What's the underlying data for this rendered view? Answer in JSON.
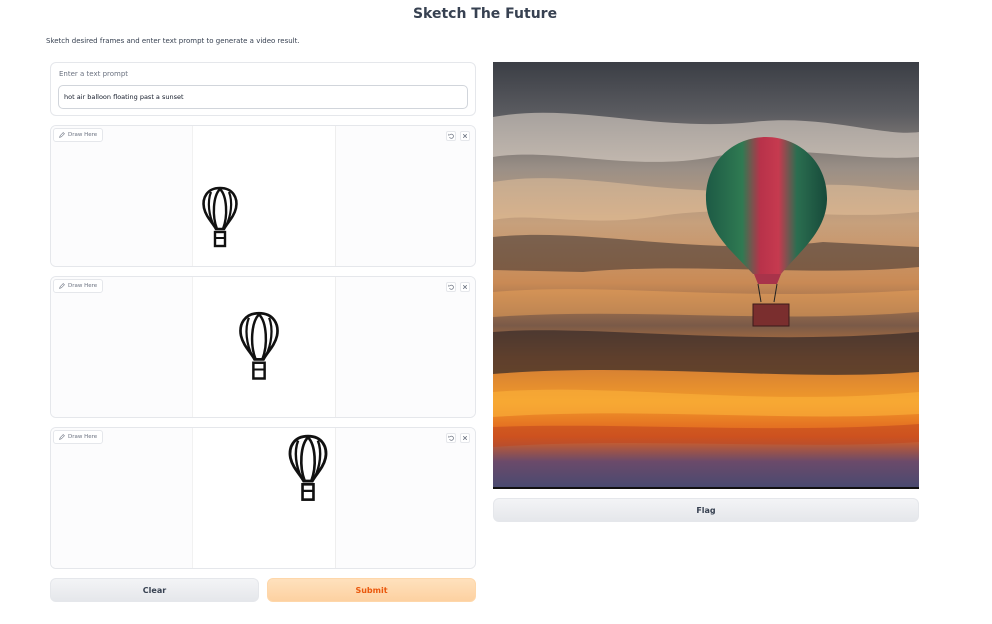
{
  "header": {
    "title": "Sketch The Future",
    "description": "Sketch desired frames and enter text prompt to generate a video result."
  },
  "prompt": {
    "label": "Enter a text prompt",
    "value": "hot air balloon floating past a sunset"
  },
  "canvases": [
    {
      "tag": "Draw Here",
      "undo_icon": "undo-icon",
      "clear_icon": "close-icon"
    },
    {
      "tag": "Draw Here",
      "undo_icon": "undo-icon",
      "clear_icon": "close-icon"
    },
    {
      "tag": "Draw Here",
      "undo_icon": "undo-icon",
      "clear_icon": "close-icon"
    }
  ],
  "buttons": {
    "clear": "Clear",
    "submit": "Submit",
    "flag": "Flag"
  },
  "colors": {
    "submit_bg": "#fdd1a1",
    "submit_text": "#ea580c",
    "neutral_button": "#e5e7eb"
  }
}
